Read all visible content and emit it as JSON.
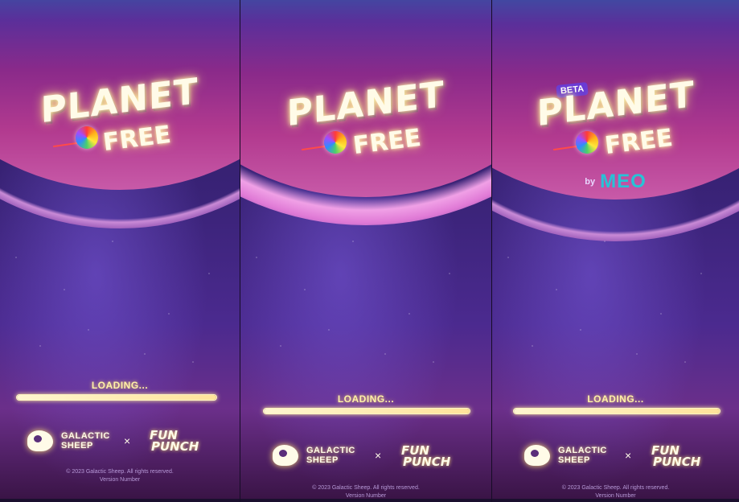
{
  "screens": [
    {
      "logo": {
        "word1": "PLANET",
        "word2": "FREE"
      },
      "loading": {
        "label": "LOADING...",
        "progress": 1.0
      },
      "brands": {
        "partner1": [
          "GALACTIC",
          "SHEEP"
        ],
        "separator": "×",
        "partner2": [
          "FUN",
          "PUNCH"
        ]
      },
      "footer": {
        "copyright": "© 2023 Galactic Sheep. All rights reserved.",
        "version": "Version Number"
      }
    },
    {
      "logo": {
        "word1": "PLANET",
        "word2": "FREE"
      },
      "loading": {
        "label": "LOADING...",
        "progress": 1.0
      },
      "brands": {
        "partner1": [
          "GALACTIC",
          "SHEEP"
        ],
        "separator": "×",
        "partner2": [
          "FUN",
          "PUNCH"
        ]
      },
      "footer": {
        "copyright": "© 2023 Galactic Sheep. All rights reserved.",
        "version": "Version Number"
      }
    },
    {
      "logo": {
        "word1": "PLANET",
        "word2": "FREE",
        "badge": "BETA",
        "sponsor_by": "by",
        "sponsor": "MEO"
      },
      "loading": {
        "label": "LOADING...",
        "progress": 1.0
      },
      "brands": {
        "partner1": [
          "GALACTIC",
          "SHEEP"
        ],
        "separator": "×",
        "partner2": [
          "FUN",
          "PUNCH"
        ]
      },
      "footer": {
        "copyright": "© 2023 Galactic Sheep. All rights reserved.",
        "version": "Version Number"
      }
    }
  ],
  "colors": {
    "accent_glow": "#ffe27a",
    "text_cream": "#fffbe8",
    "beta_badge": "#6a3bd4",
    "meo_brand": "#27c3d6"
  }
}
